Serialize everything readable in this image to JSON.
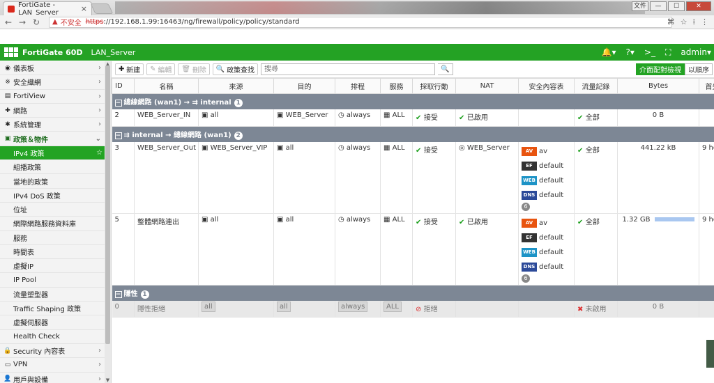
{
  "browser": {
    "tab_title": "FortiGate - LAN_Server",
    "tab_close": "×",
    "insecure_label": "不安全",
    "url_https": "https",
    "url_rest": "://192.168.1.99:16463/ng/firewall/policy/policy/standard",
    "win_buttons": [
      "文件",
      "—",
      "☐",
      "✕"
    ]
  },
  "header": {
    "model": "FortiGate 60D",
    "hostname": "LAN_Server",
    "user": "admin"
  },
  "sidebar": {
    "items": [
      {
        "icon": "dashboard-icon",
        "glyph": "◉",
        "label": "儀表板",
        "arrow": "›"
      },
      {
        "icon": "security-fabric-icon",
        "glyph": "※",
        "label": "安全織網",
        "arrow": "›"
      },
      {
        "icon": "fortiview-icon",
        "glyph": "▤",
        "label": "FortiView",
        "arrow": "›"
      },
      {
        "icon": "network-icon",
        "glyph": "✚",
        "label": "網路",
        "arrow": "›"
      },
      {
        "icon": "system-icon",
        "glyph": "✱",
        "label": "系統管理",
        "arrow": "›"
      },
      {
        "icon": "policy-icon",
        "glyph": "▣",
        "label": "政策＆物件",
        "arrow": "⌄"
      },
      {
        "label": "IPv4 政策",
        "active": true
      },
      {
        "label": "組播政策"
      },
      {
        "label": "當地的政策"
      },
      {
        "label": "IPv4 DoS 政策"
      },
      {
        "label": "位址"
      },
      {
        "label": "網際網路服務資料庫"
      },
      {
        "label": "服務"
      },
      {
        "label": "時間表"
      },
      {
        "label": "虛擬IP"
      },
      {
        "label": "IP Pool"
      },
      {
        "label": "流量塑型器"
      },
      {
        "label": "Traffic Shaping 政策"
      },
      {
        "label": "虛擬伺服器"
      },
      {
        "label": "Health Check"
      },
      {
        "icon": "lock-icon",
        "glyph": "🔒",
        "label": "Security 內容表",
        "arrow": "›"
      },
      {
        "icon": "vpn-icon",
        "glyph": "▭",
        "label": "VPN",
        "arrow": "›"
      },
      {
        "icon": "user-icon",
        "glyph": "👤",
        "label": "用戶與設備",
        "arrow": "›"
      }
    ]
  },
  "toolbar": {
    "new": "新建",
    "edit": "編輯",
    "delete": "刪除",
    "search_policy": "政策查找",
    "search_placeholder": "搜尋",
    "interface_view": "介面配對檢視",
    "sequence_view": "以順序"
  },
  "table": {
    "columns": [
      "ID",
      "名稱",
      "來源",
      "目的",
      "排程",
      "服務",
      "採取行動",
      "NAT",
      "安全內容表",
      "流量記錄",
      "Bytes",
      "首先"
    ],
    "sections": [
      {
        "title": "總線網路 (wan1) → ⇉ internal",
        "count": "1",
        "rows": [
          {
            "id": "2",
            "name": "WEB_Server_IN",
            "src": "all",
            "dst": "WEB_Server",
            "sched": "always",
            "svc": "ALL",
            "action": "接受",
            "nat": "已啟用",
            "profiles": [],
            "log": "全部",
            "bytes": "0 B",
            "first": ""
          }
        ]
      },
      {
        "title": "⇉ internal → 總線網路 (wan1)",
        "count": "2",
        "rows": [
          {
            "id": "3",
            "name": "WEB_Server_Out",
            "src": "WEB_Server_VIP",
            "dst": "all",
            "sched": "always",
            "svc": "ALL",
            "action": "接受",
            "nat": "WEB_Server",
            "profiles": [
              {
                "b": "AV",
                "t": "av"
              },
              {
                "b": "EF",
                "t": "default"
              },
              {
                "b": "WEB",
                "t": "default"
              },
              {
                "b": "DNS",
                "t": "default"
              }
            ],
            "more": "6",
            "log": "全部",
            "bytes": "441.22 kB",
            "first": "9 hou"
          },
          {
            "id": "5",
            "name": "整體網路連出",
            "src": "all",
            "dst": "all",
            "sched": "always",
            "svc": "ALL",
            "action": "接受",
            "nat": "已啟用",
            "profiles": [
              {
                "b": "AV",
                "t": "av"
              },
              {
                "b": "EF",
                "t": "default"
              },
              {
                "b": "WEB",
                "t": "default"
              },
              {
                "b": "DNS",
                "t": "default"
              }
            ],
            "more": "6",
            "log": "全部",
            "bytes": "1.32 GB",
            "first": "9 hou"
          }
        ]
      },
      {
        "title": "隱性",
        "count": "1",
        "rows": [
          {
            "id": "0",
            "name": "隱性拒絕",
            "src": "all",
            "dst": "all",
            "sched": "always",
            "svc": "ALL",
            "action": "拒絕",
            "nat": "",
            "profiles": [],
            "log": "未啟用",
            "bytes": "0 B",
            "first": ""
          }
        ]
      }
    ],
    "bytes_bar_fraction": 0.95
  },
  "colors": {
    "brand": "#24a224",
    "section": "#7d8795"
  }
}
